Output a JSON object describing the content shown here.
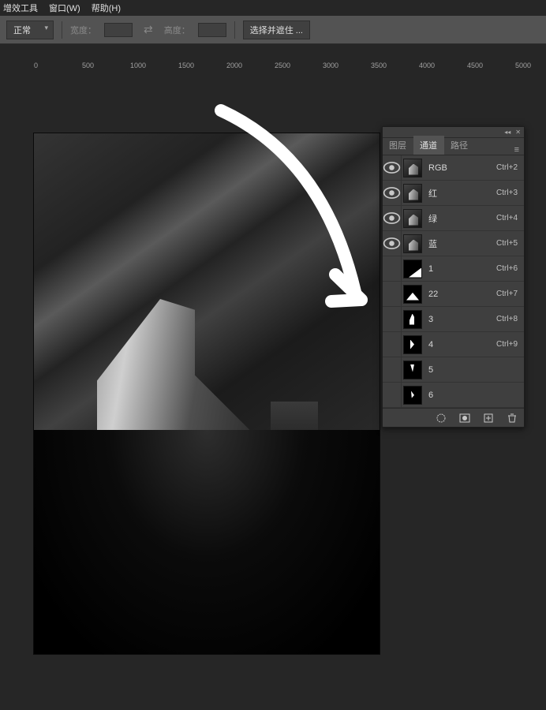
{
  "menu": {
    "plugin": "增效工具",
    "window": "窗口(W)",
    "help": "帮助(H)"
  },
  "options": {
    "mode": "正常",
    "width_label": "宽度：",
    "height_label": "高度：",
    "mask_btn": "选择并遮住 ..."
  },
  "ruler": [
    "0",
    "500",
    "1000",
    "1500",
    "2000",
    "2500",
    "3000",
    "3500",
    "4000",
    "4500",
    "5000"
  ],
  "panel": {
    "tabs": {
      "layers": "图层",
      "channels": "通道",
      "paths": "路径"
    },
    "channels": [
      {
        "name": "RGB",
        "shortcut": "Ctrl+2",
        "visible": true,
        "thumb": "rgb"
      },
      {
        "name": "红",
        "shortcut": "Ctrl+3",
        "visible": true,
        "thumb": "rgb"
      },
      {
        "name": "绿",
        "shortcut": "Ctrl+4",
        "visible": true,
        "thumb": "rgb"
      },
      {
        "name": "蓝",
        "shortcut": "Ctrl+5",
        "visible": true,
        "thumb": "rgb"
      },
      {
        "name": "1",
        "shortcut": "Ctrl+6",
        "visible": false,
        "thumb": "alpha1"
      },
      {
        "name": "22",
        "shortcut": "Ctrl+7",
        "visible": false,
        "thumb": "alpha2"
      },
      {
        "name": "3",
        "shortcut": "Ctrl+8",
        "visible": false,
        "thumb": "alpha3"
      },
      {
        "name": "4",
        "shortcut": "Ctrl+9",
        "visible": false,
        "thumb": "alpha4"
      },
      {
        "name": "5",
        "shortcut": "",
        "visible": false,
        "thumb": "alpha5"
      },
      {
        "name": "6",
        "shortcut": "",
        "visible": false,
        "thumb": "alpha6"
      }
    ]
  }
}
